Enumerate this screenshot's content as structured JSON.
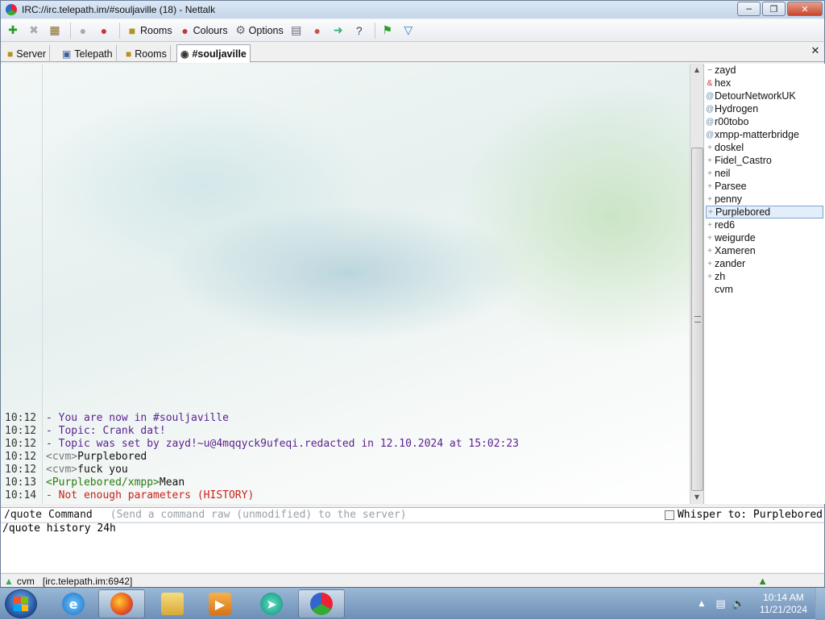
{
  "window": {
    "title": "IRC://irc.telepath.im/#souljaville (18)  -  Nettalk",
    "colors": {
      "purple": "#5b1f8f",
      "red": "#c8221a",
      "green": "#2b7a12"
    }
  },
  "toolbar": {
    "items": [
      {
        "name": "connect-icon",
        "label": ""
      },
      {
        "name": "disconnect-icon",
        "label": ""
      },
      {
        "name": "properties-icon",
        "label": ""
      },
      {
        "name": "user-icon",
        "label": ""
      },
      {
        "name": "user-badge-icon",
        "label": ""
      },
      {
        "name": "rooms-icon",
        "label": "Rooms"
      },
      {
        "name": "colours-icon",
        "label": "Colours"
      },
      {
        "name": "options-icon",
        "label": "Options"
      },
      {
        "name": "clipboard-icon",
        "label": ""
      },
      {
        "name": "users-icon",
        "label": ""
      },
      {
        "name": "export-icon",
        "label": ""
      },
      {
        "name": "help-icon",
        "label": ""
      },
      {
        "name": "flag-icon",
        "label": ""
      },
      {
        "name": "dropdown-icon",
        "label": ""
      }
    ]
  },
  "tabs": [
    {
      "label": "Server",
      "icon": "folder-icon"
    },
    {
      "label": "Telepath",
      "icon": "network-icon"
    },
    {
      "label": "Rooms",
      "icon": "rooms-icon"
    },
    {
      "label": "#souljaville",
      "icon": "channel-icon"
    }
  ],
  "chat": {
    "lines": [
      {
        "time": "10:12",
        "parts": [
          {
            "text": "- You are now in #souljaville",
            "color": "purple"
          }
        ]
      },
      {
        "time": "10:12",
        "parts": [
          {
            "text": "- Topic: Crank dat!",
            "color": "purple"
          }
        ]
      },
      {
        "time": "10:12",
        "parts": [
          {
            "text": "- Topic was set by zayd!~u@4mqqyck9ufeqi.redacted in 12.10.2024 at 15:02:23",
            "color": "purple"
          }
        ]
      },
      {
        "time": "10:12",
        "parts": [
          {
            "text": "<cvm>",
            "color": "grey"
          },
          {
            "text": "Purplebored",
            "color": "dark"
          }
        ]
      },
      {
        "time": "10:12",
        "parts": [
          {
            "text": "<cvm>",
            "color": "grey"
          },
          {
            "text": "fuck you",
            "color": "dark"
          }
        ]
      },
      {
        "time": "10:13",
        "parts": [
          {
            "text": "<Purplebored/xmpp>",
            "color": "green"
          },
          {
            "text": "Mean",
            "color": "dark"
          }
        ]
      },
      {
        "time": "10:14",
        "parts": [
          {
            "text": "- Not enough parameters (HISTORY)",
            "color": "red"
          }
        ]
      }
    ]
  },
  "nicklist": [
    {
      "prefix": "~",
      "name": "zayd"
    },
    {
      "prefix": "&",
      "name": "hex"
    },
    {
      "prefix": "@",
      "name": "DetourNetworkUK"
    },
    {
      "prefix": "@",
      "name": "Hydrogen"
    },
    {
      "prefix": "@",
      "name": "r00tobo"
    },
    {
      "prefix": "@",
      "name": "xmpp-matterbridge"
    },
    {
      "prefix": "+",
      "name": "doskel"
    },
    {
      "prefix": "+",
      "name": "Fidel_Castro"
    },
    {
      "prefix": "+",
      "name": "neil"
    },
    {
      "prefix": "+",
      "name": "Parsee"
    },
    {
      "prefix": "+",
      "name": "penny"
    },
    {
      "prefix": "+",
      "name": "Purplebored",
      "selected": true
    },
    {
      "prefix": "+",
      "name": "red6"
    },
    {
      "prefix": "+",
      "name": "weigurde"
    },
    {
      "prefix": "+",
      "name": "Xameren"
    },
    {
      "prefix": "+",
      "name": "zander"
    },
    {
      "prefix": "+",
      "name": "zh"
    },
    {
      "prefix": "",
      "name": "cvm"
    }
  ],
  "command": {
    "name": "/quote",
    "label": "Command",
    "hint": "(Send a command raw (unmodified) to the server)",
    "whisper": "Whisper to: Purplebored"
  },
  "input": {
    "value": "/quote history 24h"
  },
  "status": {
    "nick": "cvm",
    "server": "[irc.telepath.im:6942]"
  },
  "taskbar": {
    "apps": [
      "internet-explorer-icon",
      "firefox-icon",
      "file-explorer-icon",
      "media-player-icon",
      "chat-app-icon",
      "nettalk-icon"
    ],
    "time": "10:14 AM",
    "date": "11/21/2024"
  }
}
